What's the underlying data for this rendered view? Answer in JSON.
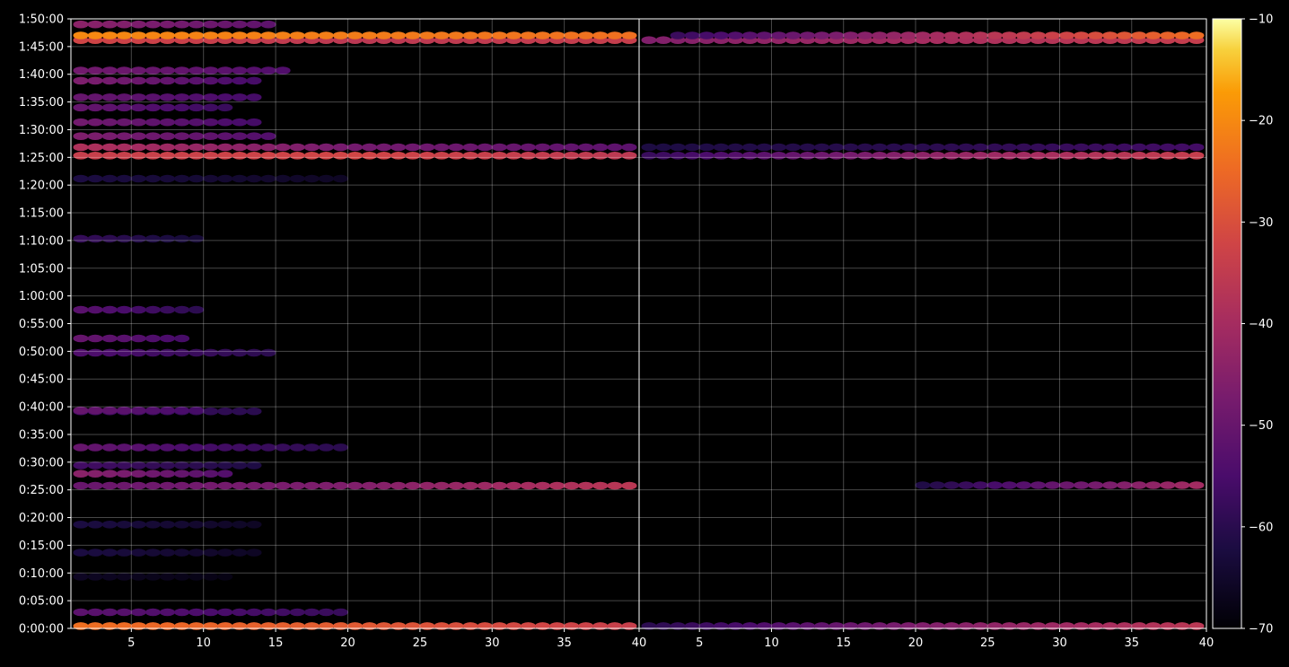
{
  "chart_data": {
    "type": "heatmap",
    "title": "",
    "xlabel": "",
    "ylabel": "",
    "grid": true,
    "panels": 2,
    "x_range": [
      1,
      40
    ],
    "x_ticks": [
      5,
      10,
      15,
      20,
      25,
      30,
      35,
      40
    ],
    "y_range_seconds": [
      0,
      6600
    ],
    "y_tick_labels": [
      "0:00:00",
      "0:05:00",
      "0:10:00",
      "0:15:00",
      "0:20:00",
      "0:25:00",
      "0:30:00",
      "0:35:00",
      "0:40:00",
      "0:45:00",
      "0:50:00",
      "0:55:00",
      "1:00:00",
      "1:05:00",
      "1:10:00",
      "1:15:00",
      "1:20:00",
      "1:25:00",
      "1:30:00",
      "1:35:00",
      "1:40:00",
      "1:45:00",
      "1:50:00"
    ],
    "colorbar": {
      "colormap": "inferno",
      "range": [
        -70,
        -10
      ],
      "tick_labels": [
        "−70",
        "−60",
        "−50",
        "−40",
        "−30",
        "−20",
        "−10"
      ],
      "tick_values": [
        -70,
        -60,
        -50,
        -40,
        -30,
        -20,
        -10
      ]
    },
    "left_panel_bands": [
      {
        "t": 25,
        "x": [
          1,
          40
        ],
        "v": [
          -24,
          -28,
          -34
        ]
      },
      {
        "t": 175,
        "x": [
          1,
          20
        ],
        "v": [
          -52,
          -58
        ]
      },
      {
        "t": 560,
        "x": [
          1,
          12
        ],
        "v": [
          -66,
          -68
        ]
      },
      {
        "t": 820,
        "x": [
          1,
          14
        ],
        "v": [
          -62,
          -66
        ]
      },
      {
        "t": 1125,
        "x": [
          1,
          14
        ],
        "v": [
          -62,
          -66
        ]
      },
      {
        "t": 1545,
        "x": [
          1,
          40
        ],
        "v": [
          -50,
          -46,
          -36
        ]
      },
      {
        "t": 1675,
        "x": [
          1,
          12
        ],
        "v": [
          -44,
          -54
        ]
      },
      {
        "t": 1765,
        "x": [
          1,
          14
        ],
        "v": [
          -56,
          -62
        ]
      },
      {
        "t": 1960,
        "x": [
          1,
          20
        ],
        "v": [
          -50,
          -56,
          -60
        ]
      },
      {
        "t": 2350,
        "x": [
          1,
          14
        ],
        "v": [
          -56,
          -60
        ]
      },
      {
        "t": 2360,
        "x": [
          1,
          10
        ],
        "v": [
          -50,
          -56
        ]
      },
      {
        "t": 2985,
        "x": [
          1,
          15
        ],
        "v": [
          -54,
          -60
        ]
      },
      {
        "t": 3140,
        "x": [
          1,
          9
        ],
        "v": [
          -50,
          -56
        ]
      },
      {
        "t": 3450,
        "x": [
          1,
          10
        ],
        "v": [
          -52,
          -60
        ]
      },
      {
        "t": 4220,
        "x": [
          1,
          10
        ],
        "v": [
          -58,
          -64
        ]
      },
      {
        "t": 4870,
        "x": [
          1,
          20
        ],
        "v": [
          -62,
          -66
        ]
      },
      {
        "t": 5120,
        "x": [
          1,
          40
        ],
        "v": [
          -34,
          -32,
          -36
        ]
      },
      {
        "t": 5210,
        "x": [
          1,
          40
        ],
        "v": [
          -38,
          -48,
          -52
        ]
      },
      {
        "t": 5330,
        "x": [
          1,
          15
        ],
        "v": [
          -46,
          -54
        ]
      },
      {
        "t": 5480,
        "x": [
          1,
          14
        ],
        "v": [
          -48,
          -56
        ]
      },
      {
        "t": 5640,
        "x": [
          1,
          12
        ],
        "v": [
          -50,
          -58
        ]
      },
      {
        "t": 5750,
        "x": [
          1,
          14
        ],
        "v": [
          -50,
          -56
        ]
      },
      {
        "t": 5930,
        "x": [
          1,
          14
        ],
        "v": [
          -46,
          -56
        ]
      },
      {
        "t": 6040,
        "x": [
          1,
          16
        ],
        "v": [
          -48,
          -54
        ]
      },
      {
        "t": 6370,
        "x": [
          1,
          40
        ],
        "v": [
          -32,
          -36,
          -34
        ]
      },
      {
        "t": 6420,
        "x": [
          1,
          40
        ],
        "v": [
          -20,
          -22,
          -24
        ]
      },
      {
        "t": 6540,
        "x": [
          1,
          15
        ],
        "v": [
          -44,
          -52
        ]
      }
    ],
    "right_panel_bands": [
      {
        "t": 25,
        "x": [
          1,
          40
        ],
        "v": [
          -60,
          -46,
          -36
        ]
      },
      {
        "t": 1550,
        "x": [
          20,
          40
        ],
        "v": [
          -62,
          -50,
          -40
        ]
      },
      {
        "t": 5120,
        "x": [
          1,
          40
        ],
        "v": [
          -58,
          -44,
          -34
        ]
      },
      {
        "t": 5210,
        "x": [
          1,
          40
        ],
        "v": [
          -62,
          -60,
          -56
        ]
      },
      {
        "t": 6370,
        "x": [
          1,
          40
        ],
        "v": [
          -46,
          -40,
          -34
        ]
      },
      {
        "t": 6420,
        "x": [
          3,
          40
        ],
        "v": [
          -58,
          -40,
          -24
        ]
      }
    ]
  }
}
